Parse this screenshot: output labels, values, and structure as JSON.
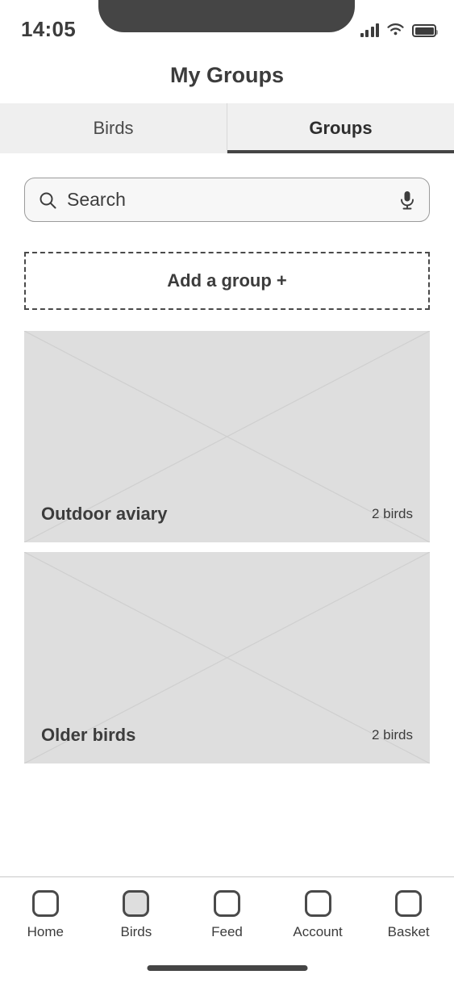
{
  "status_bar": {
    "time": "14:05",
    "signal_icon": "cellular-signal-icon",
    "wifi_icon": "wifi-icon",
    "battery_icon": "battery-full-icon"
  },
  "header": {
    "title": "My Groups"
  },
  "tabs": [
    {
      "label": "Birds",
      "active": false
    },
    {
      "label": "Groups",
      "active": true
    }
  ],
  "search": {
    "placeholder": "Search",
    "value": "",
    "search_icon": "search-icon",
    "mic_icon": "microphone-icon"
  },
  "add_group": {
    "label": "Add a group +"
  },
  "groups": [
    {
      "name": "Outdoor aviary",
      "count": "2 birds",
      "image": "image-placeholder"
    },
    {
      "name": "Older birds",
      "count": "2 birds",
      "image": "image-placeholder"
    }
  ],
  "bottom_nav": [
    {
      "label": "Home",
      "icon": "home-icon",
      "active": false
    },
    {
      "label": "Birds",
      "icon": "birds-icon",
      "active": true
    },
    {
      "label": "Feed",
      "icon": "feed-icon",
      "active": false
    },
    {
      "label": "Account",
      "icon": "account-icon",
      "active": false
    },
    {
      "label": "Basket",
      "icon": "basket-icon",
      "active": false
    }
  ],
  "colors": {
    "text_primary": "#3c3c3c",
    "tab_bar_bg": "#efefef",
    "card_bg": "#dedede",
    "accent_underline": "#444444",
    "notch": "#454545"
  }
}
